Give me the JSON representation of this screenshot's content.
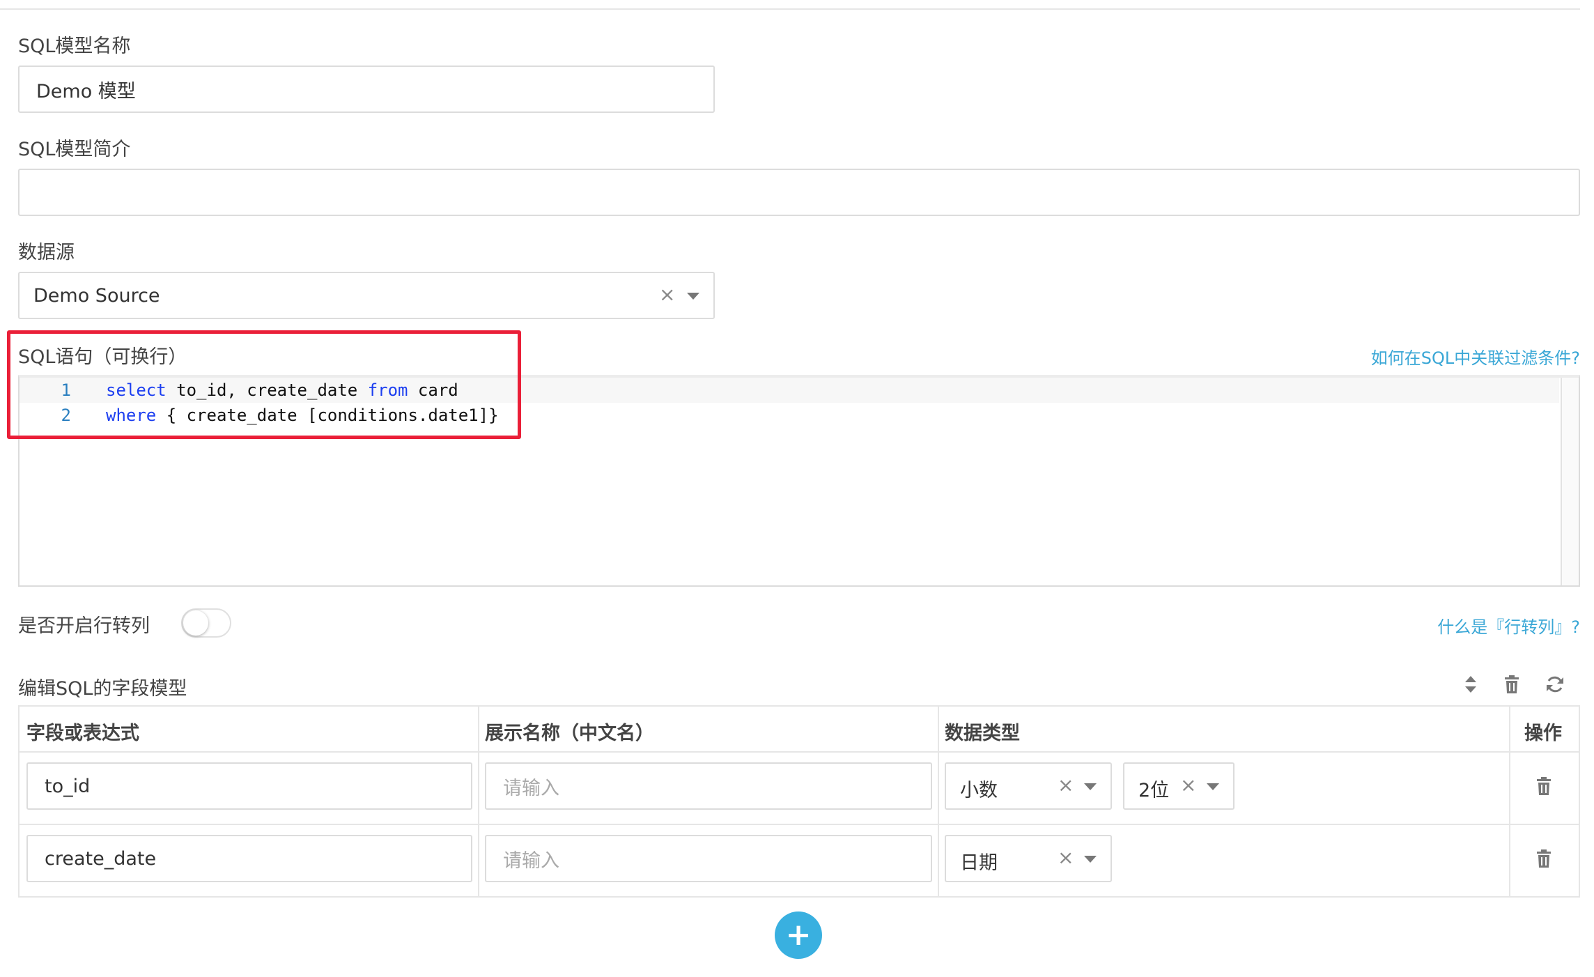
{
  "form": {
    "name_label": "SQL模型名称",
    "name_value": "Demo 模型",
    "desc_label": "SQL模型简介",
    "desc_value": "",
    "source_label": "数据源",
    "source_value": "Demo Source",
    "clear_glyph": "×",
    "sql_label": "SQL语句（可换行）",
    "sql_help_link": "如何在SQL中关联过滤条件?",
    "sql_lines": [
      {
        "num": "1",
        "kw": "select",
        "rest": " to_id, create_date ",
        "kw2": "from",
        "rest2": " card"
      },
      {
        "num": "2",
        "kw": "where",
        "rest": " { create_date [conditions.date1]}",
        "kw2": "",
        "rest2": ""
      }
    ],
    "pivot_label": "是否开启行转列",
    "pivot_enabled": false,
    "pivot_help_link": "什么是『行转列』?"
  },
  "fields": {
    "section_title": "编辑SQL的字段模型",
    "toolbar_icons": [
      "sort-icon",
      "trash-icon",
      "refresh-icon"
    ],
    "columns": [
      "字段或表达式",
      "展示名称（中文名）",
      "数据类型",
      "操作"
    ],
    "rows": [
      {
        "field": "to_id",
        "display_placeholder": "请输入",
        "type": "小数",
        "precision": "2位"
      },
      {
        "field": "create_date",
        "display_placeholder": "请输入",
        "type": "日期",
        "precision": ""
      }
    ],
    "add_glyph": "+"
  },
  "colors": {
    "accent": "#39b0e0",
    "highlight": "#ea1f38",
    "keyword": "#1d3ff0"
  }
}
